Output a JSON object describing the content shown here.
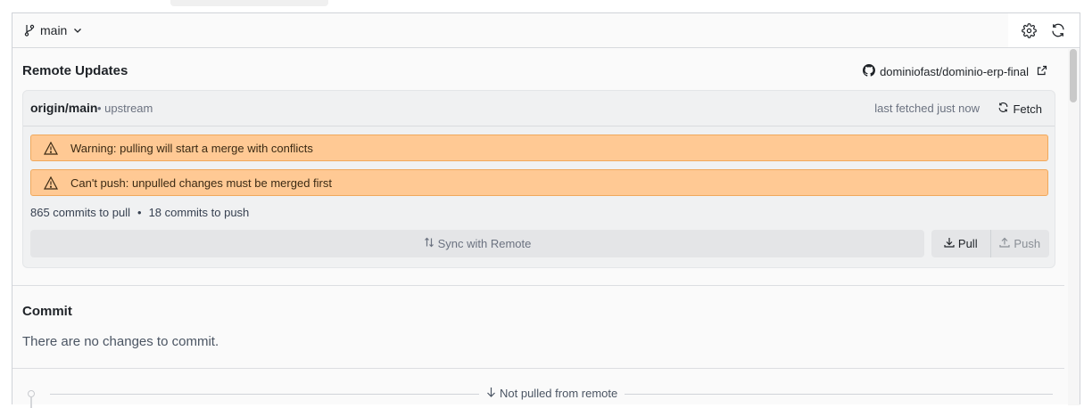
{
  "toolbar": {
    "branch": "main",
    "icons": [
      "branch-icon",
      "chevron-down-icon",
      "gear-icon",
      "refresh-icon"
    ]
  },
  "remote": {
    "title": "Remote Updates",
    "repo": "dominiofast/dominio-erp-final",
    "upstream_name": "origin/main",
    "upstream_tag": "• upstream",
    "fetched": "last fetched just now",
    "fetch_label": "Fetch",
    "warnings": [
      "Warning: pulling will start a merge with conflicts",
      "Can't push: unpulled changes must be merged first"
    ],
    "pull_count": "865 commits to pull",
    "separator": "•",
    "push_count": "18 commits to push",
    "sync_label": "Sync with Remote",
    "pull_label": "Pull",
    "push_label": "Push"
  },
  "commit": {
    "title": "Commit",
    "empty_message": "There are no changes to commit."
  },
  "history": {
    "not_pulled_label": "Not pulled from remote"
  },
  "colors": {
    "warning_bg": "#ffc994",
    "warning_border": "#f0a85c",
    "panel_bg": "#fafafa"
  }
}
